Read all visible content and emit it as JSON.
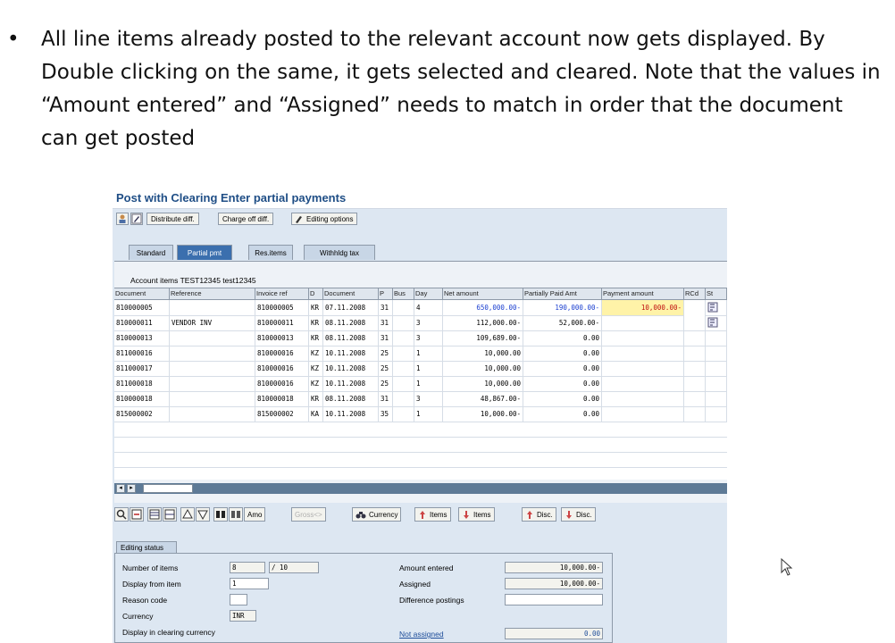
{
  "slide": {
    "bullet": "•",
    "text": "All line items already posted to the relevant account now gets displayed. By Double clicking on the same, it gets selected and cleared. Note that the values in “Amount entered” and “Assigned” needs to match in order that the document can get posted"
  },
  "window": {
    "title": "Post with Clearing Enter partial payments"
  },
  "toolbar": {
    "distribute": "Distribute diff.",
    "charge_off": "Charge off diff.",
    "editing_options": "Editing options"
  },
  "tabs": {
    "standard": "Standard",
    "partial": "Partial pmt",
    "res_items": "Res.items",
    "withholding": "Withhldg tax"
  },
  "grid": {
    "caption": "Account items TEST12345 test12345",
    "headers": {
      "document": "Document",
      "reference": "Reference",
      "invoice_ref": "Invoice ref",
      "d": "D",
      "document2": "Document",
      "p": "P",
      "bus": "Bus",
      "day": "Day",
      "net_amount": "Net amount",
      "partially_paid": "Partially Paid Amt",
      "payment_amount": "Payment amount",
      "rcd": "RCd",
      "st": "St"
    },
    "rows": [
      {
        "document": "810000005",
        "reference": "",
        "invoice_ref": "810000005",
        "d": "KR",
        "date": "07.11.2008",
        "p": "31",
        "bus": "",
        "day": "4",
        "net": "650,000.00-",
        "paid": "190,000.00-",
        "pay": "10,000.00-"
      },
      {
        "document": "810000011",
        "reference": "VENDOR INV",
        "invoice_ref": "810000011",
        "d": "KR",
        "date": "08.11.2008",
        "p": "31",
        "bus": "",
        "day": "3",
        "net": "112,000.00-",
        "paid": "52,000.00-",
        "pay": ""
      },
      {
        "document": "810000013",
        "reference": "",
        "invoice_ref": "810000013",
        "d": "KR",
        "date": "08.11.2008",
        "p": "31",
        "bus": "",
        "day": "3",
        "net": "109,689.00-",
        "paid": "0.00",
        "pay": ""
      },
      {
        "document": "811000016",
        "reference": "",
        "invoice_ref": "810000016",
        "d": "KZ",
        "date": "10.11.2008",
        "p": "25",
        "bus": "",
        "day": "1",
        "net": "10,000.00",
        "paid": "0.00",
        "pay": ""
      },
      {
        "document": "811000017",
        "reference": "",
        "invoice_ref": "810000016",
        "d": "KZ",
        "date": "10.11.2008",
        "p": "25",
        "bus": "",
        "day": "1",
        "net": "10,000.00",
        "paid": "0.00",
        "pay": ""
      },
      {
        "document": "811000018",
        "reference": "",
        "invoice_ref": "810000016",
        "d": "KZ",
        "date": "10.11.2008",
        "p": "25",
        "bus": "",
        "day": "1",
        "net": "10,000.00",
        "paid": "0.00",
        "pay": ""
      },
      {
        "document": "810000018",
        "reference": "",
        "invoice_ref": "810000018",
        "d": "KR",
        "date": "08.11.2008",
        "p": "31",
        "bus": "",
        "day": "3",
        "net": "48,867.00-",
        "paid": "0.00",
        "pay": ""
      },
      {
        "document": "815000002",
        "reference": "",
        "invoice_ref": "815000002",
        "d": "KA",
        "date": "10.11.2008",
        "p": "35",
        "bus": "",
        "day": "1",
        "net": "10,000.00-",
        "paid": "0.00",
        "pay": ""
      }
    ]
  },
  "bottom_toolbar": {
    "amo": "Amo",
    "gross": "Gross<>",
    "currency": "Currency",
    "items1": "Items",
    "items2": "Items",
    "disc1": "Disc.",
    "disc2": "Disc."
  },
  "editing": {
    "tab": "Editing status",
    "number_items_label": "Number of items",
    "number_items_value": "8",
    "number_items_total": "/ 10",
    "display_from_label": "Display from item",
    "display_from_value": "1",
    "reason_code_label": "Reason code",
    "currency_label": "Currency",
    "currency_value": "INR",
    "display_clearing_label": "Display in clearing currency",
    "amount_entered_label": "Amount entered",
    "amount_entered_value": "10,000.00-",
    "assigned_label": "Assigned",
    "assigned_value": "10,000.00-",
    "difference_label": "Difference postings",
    "not_assigned_label": "Not assigned",
    "not_assigned_value": "0.00"
  },
  "colors": {
    "title": "#1f4e86",
    "tab_active": "#3b6fae",
    "payment_highlight": "#fff3a8",
    "net_amount_blue": "#1b3fd0"
  }
}
